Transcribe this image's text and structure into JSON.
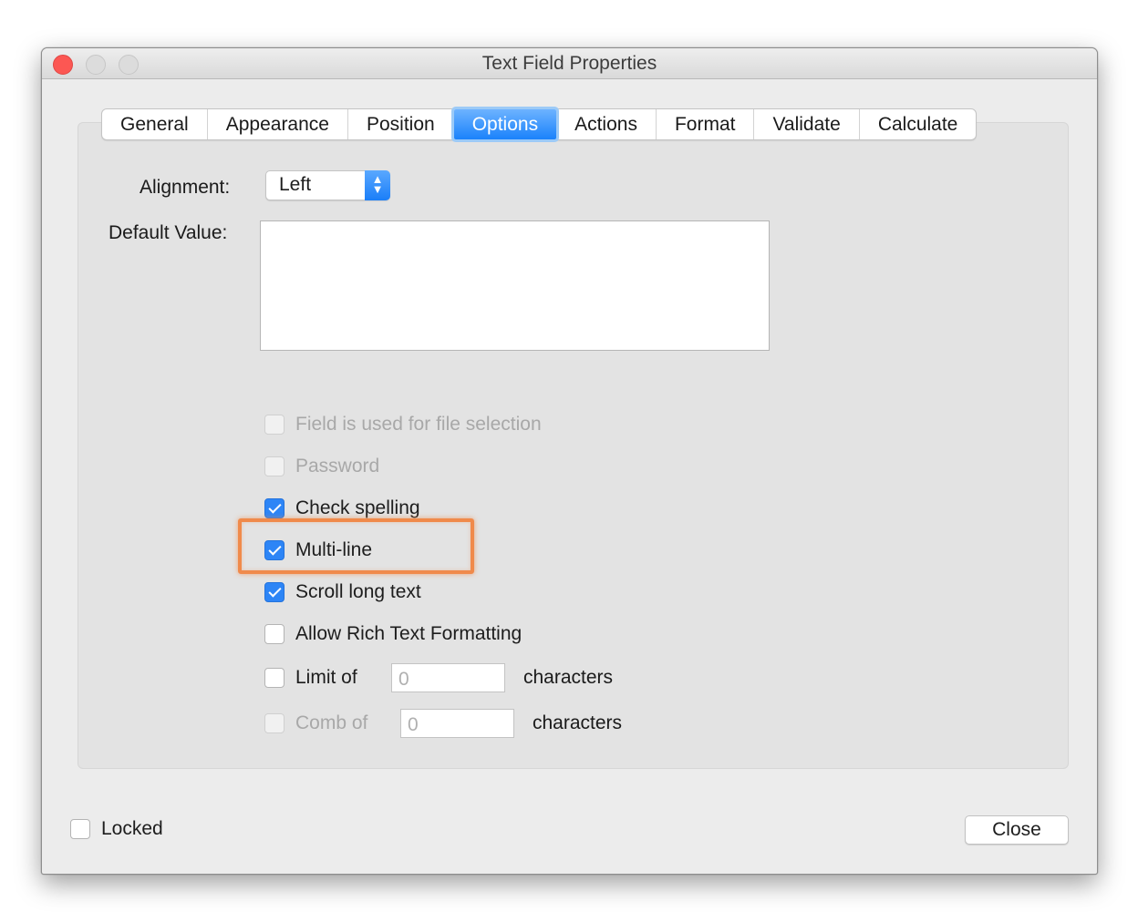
{
  "window": {
    "title": "Text Field Properties"
  },
  "tabs": [
    {
      "label": "General"
    },
    {
      "label": "Appearance"
    },
    {
      "label": "Position"
    },
    {
      "label": "Options",
      "active": true
    },
    {
      "label": "Actions"
    },
    {
      "label": "Format"
    },
    {
      "label": "Validate"
    },
    {
      "label": "Calculate"
    }
  ],
  "options": {
    "alignment_label": "Alignment:",
    "alignment_value": "Left",
    "default_value_label": "Default Value:",
    "default_value": "",
    "checkboxes": [
      {
        "label": "Field is used for file selection",
        "checked": false,
        "enabled": false
      },
      {
        "label": "Password",
        "checked": false,
        "enabled": false
      },
      {
        "label": "Check spelling",
        "checked": true,
        "enabled": true
      },
      {
        "label": "Multi-line",
        "checked": true,
        "enabled": true,
        "highlighted": true
      },
      {
        "label": "Scroll long text",
        "checked": true,
        "enabled": true
      },
      {
        "label": "Allow Rich Text Formatting",
        "checked": false,
        "enabled": true
      }
    ],
    "limit": {
      "label": "Limit of",
      "value": "0",
      "suffix": "characters",
      "checked": false,
      "enabled": true
    },
    "comb": {
      "label": "Comb of",
      "value": "0",
      "suffix": "characters",
      "checked": false,
      "enabled": false
    }
  },
  "footer": {
    "locked_label": "Locked",
    "locked_checked": false,
    "close_label": "Close"
  },
  "colors": {
    "accent": "#1a82fb",
    "highlight": "#f08a4b"
  }
}
